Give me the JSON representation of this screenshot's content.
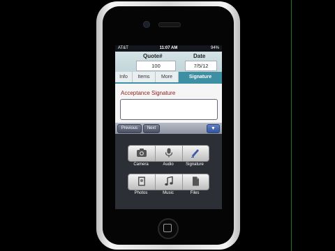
{
  "status_bar": {
    "carrier": "AT&T",
    "time": "11:07 AM",
    "battery": "94%"
  },
  "header": {
    "quote_label": "Quote#",
    "quote_value": "100",
    "date_label": "Date",
    "date_value": "7/5/12"
  },
  "tabs": [
    {
      "label": "Info",
      "active": false
    },
    {
      "label": "Items",
      "active": false
    },
    {
      "label": "More",
      "active": false
    },
    {
      "label": "Signature",
      "active": true
    }
  ],
  "signature": {
    "label": "Acceptance Signature"
  },
  "accessory": {
    "previous_label": "Previous",
    "next_label": "Next",
    "dismiss_icon": "chevron-down-icon"
  },
  "media_sheet": {
    "row1": [
      {
        "label": "Camera",
        "icon": "camera-icon"
      },
      {
        "label": "Audio",
        "icon": "microphone-icon"
      },
      {
        "label": "Signature",
        "icon": "pen-icon"
      }
    ],
    "row2": [
      {
        "label": "Photos",
        "icon": "photo-icon"
      },
      {
        "label": "Music",
        "icon": "music-note-icon"
      },
      {
        "label": "Files",
        "icon": "file-icon"
      }
    ]
  },
  "colors": {
    "accent": "#3d8fa3",
    "signature_label": "#8b1a1a",
    "sheet_bg": "#2c2f36"
  }
}
